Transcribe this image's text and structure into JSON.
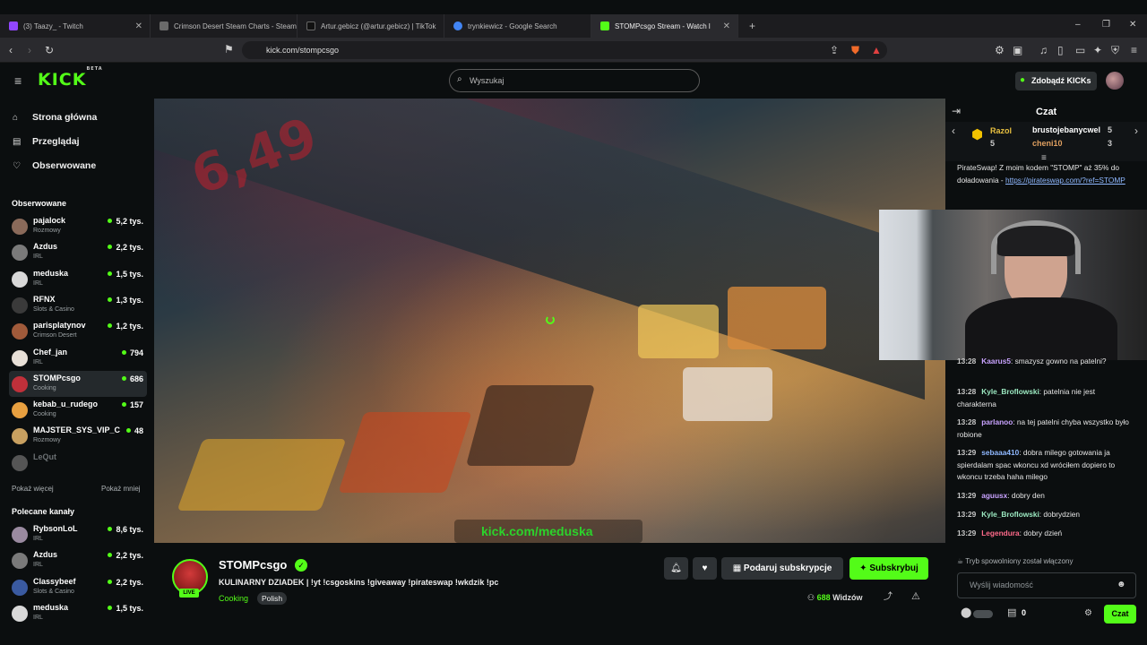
{
  "browser": {
    "tabs": [
      {
        "label": "(3) Taazy_ - Twitch",
        "color": "#9146ff"
      },
      {
        "label": "Crimson Desert Steam Charts - Steam",
        "color": "#6a6a6a"
      },
      {
        "label": "Artur.gebicz (@artur.gebicz) | TikTok",
        "color": "#111111"
      },
      {
        "label": "trynkiewicz - Google Search",
        "color": "#4285f4"
      },
      {
        "label": "STOMPcsgo Stream - Watch l",
        "color": "#53fc18"
      }
    ],
    "url": "kick.com/stompcsgo",
    "new_tab": "+",
    "minimize": "–",
    "maximize": "❐",
    "close": "✕"
  },
  "header": {
    "logo": "KICK",
    "logo_sup": "BETA",
    "search_placeholder": "Wyszukaj",
    "kicks_button": "Zdobądź KICKs"
  },
  "sidebar": {
    "nav": [
      {
        "label": "Strona główna",
        "icon": "⌂"
      },
      {
        "label": "Przeglądaj",
        "icon": "▤"
      },
      {
        "label": "Obserwowane",
        "icon": "♡"
      }
    ],
    "followed_title": "Obserwowane",
    "followed": [
      {
        "name": "pajalock",
        "category": "Rozmowy",
        "viewers": "5,2 tys.",
        "color": "#8a6a5a"
      },
      {
        "name": "Azdus",
        "category": "IRL",
        "viewers": "2,2 tys.",
        "color": "#7a7a7a"
      },
      {
        "name": "meduska",
        "category": "IRL",
        "viewers": "1,5 tys.",
        "color": "#d8d8d8"
      },
      {
        "name": "RFNX",
        "category": "Slots & Casino",
        "viewers": "1,3 tys.",
        "color": "#3a3a3a"
      },
      {
        "name": "parisplatynov",
        "category": "Crimson Desert",
        "viewers": "1,2 tys.",
        "color": "#a05a3a"
      },
      {
        "name": "Chef_jan",
        "category": "IRL",
        "viewers": "794",
        "color": "#e8e0d8"
      },
      {
        "name": "STOMPcsgo",
        "category": "Cooking",
        "viewers": "686",
        "color": "#c0303a"
      },
      {
        "name": "kebab_u_rudego",
        "category": "Cooking",
        "viewers": "157",
        "color": "#e8a040"
      },
      {
        "name": "MAJSTER_SYS_VIP_C",
        "category": "Rozmowy",
        "viewers": "48",
        "color": "#c8a060"
      },
      {
        "name": "LeQut",
        "category": "",
        "viewers": "",
        "color": "#555555"
      }
    ],
    "show_more": "Pokaż więcej",
    "show_less": "Pokaż mniej",
    "recommended_title": "Polecane kanały",
    "recommended": [
      {
        "name": "RybsonLoL",
        "category": "IRL",
        "viewers": "8,6 tys.",
        "color": "#9a8aa0"
      },
      {
        "name": "Azdus",
        "category": "IRL",
        "viewers": "2,2 tys.",
        "color": "#7a7a7a"
      },
      {
        "name": "Classybeef",
        "category": "Slots & Casino",
        "viewers": "2,2 tys.",
        "color": "#3a5aa0"
      },
      {
        "name": "meduska",
        "category": "IRL",
        "viewers": "1,5 tys.",
        "color": "#d8d8d8"
      }
    ]
  },
  "video": {
    "watermark": "kick.com/meduska",
    "price": "6,49"
  },
  "stream": {
    "name": "STOMPcsgo",
    "live": "LIVE",
    "title": "KULINARNY DZIADEK | !yt !csgoskins !giveaway !pirateswap !wkdzik !pc",
    "category": "Cooking",
    "tag": "Polish",
    "viewers_count": "688",
    "viewers_label": "Widzów",
    "gift_sub": "Podaruj subskrypcje",
    "subscribe": "Subskrybuj"
  },
  "chat": {
    "title": "Czat",
    "leaderboard": [
      {
        "name": "Razol",
        "value": "5"
      },
      {
        "name": "brustojebanycwel",
        "value": "5"
      },
      {
        "name": "cheni10",
        "value": "3"
      }
    ],
    "pinned_text": "PirateSwap! Z moim kodem \"STOMP\" aż 35% do doładowania - ",
    "pinned_link": "https://pirateswap.com/?ref=STOMP",
    "messages": [
      {
        "time": "13:28",
        "user": "Kaarus5",
        "color": "#c9a3ff",
        "text": "smazysz gowno na patelni?"
      },
      {
        "time": "13:28",
        "user": "Kyle_Broflowski",
        "color": "#9be8c0",
        "text": "patelnia nie jest charakterna"
      },
      {
        "time": "13:28",
        "user": "parlanoo",
        "color": "#c9a3ff",
        "text": "na tej patelni chyba wszystko było robione"
      },
      {
        "time": "13:29",
        "user": "sebaaa410",
        "color": "#8fb8ff",
        "text": "dobra milego gotowania ja spierdalam spac wkoncu xd wróciłem dopiero to wkoncu trzeba haha milego"
      },
      {
        "time": "13:29",
        "user": "aguusx",
        "color": "#c9a3ff",
        "text": "dobry den"
      },
      {
        "time": "13:29",
        "user": "Kyle_Broflowski",
        "color": "#9be8c0",
        "text": "dobrydzien"
      },
      {
        "time": "13:29",
        "user": "Legendura",
        "color": "#ff6a8a",
        "text": "dobry dzień"
      }
    ],
    "slow_mode": "Tryb spowolniony został włączony",
    "input_placeholder": "Wyślij wiadomość",
    "points": "0",
    "send": "Czat"
  }
}
